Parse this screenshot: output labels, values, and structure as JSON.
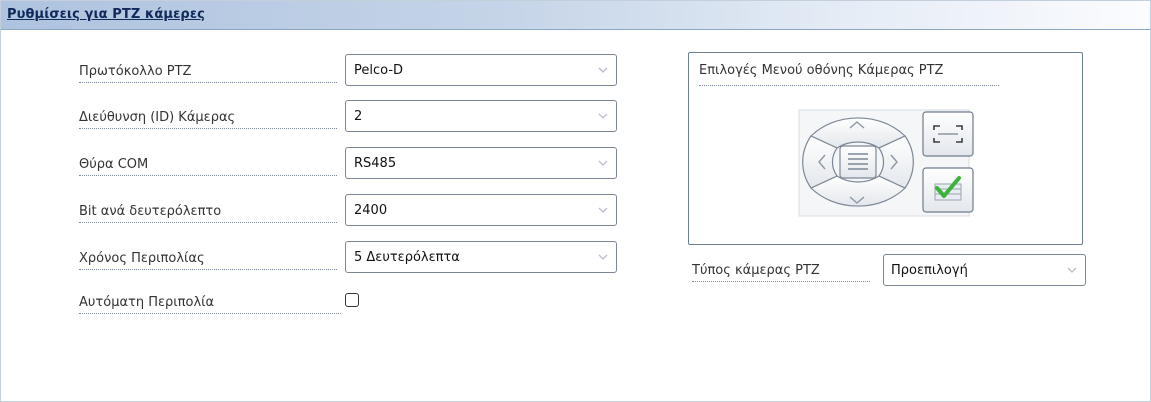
{
  "panel": {
    "title": "Ρυθμίσεις για PTZ κάμερες"
  },
  "settings": {
    "protocol_label": "Πρωτόκολλο PTZ",
    "protocol_value": "Pelco-D",
    "camera_id_label": "Διεύθυνση (ID) Κάμερας",
    "camera_id_value": "2",
    "com_port_label": "Θύρα COM",
    "com_port_value": "RS485",
    "baud_label": "Bit ανά δευτερόλεπτο",
    "baud_value": "2400",
    "patrol_time_label": "Χρόνος Περιπολίας",
    "patrol_time_value": "5 Δευτερόλεπτα",
    "auto_patrol_label": "Αυτόματη Περιπολία",
    "auto_patrol_checked": false
  },
  "osd_menu": {
    "title": "Επιλογές Μενού οθόνης Κάμερας PTZ",
    "icons": [
      "chevron-up-icon",
      "chevron-left-icon",
      "menu-icon",
      "chevron-right-icon",
      "chevron-down-icon",
      "fullscreen-icon",
      "checkmark-icon"
    ]
  },
  "ptz_type": {
    "label": "Τύπος κάμερας PTZ",
    "value": "Προεπιλογή"
  },
  "colors": {
    "header_start": "#aec3df",
    "header_text": "#10285a",
    "control_border": "#7d8694",
    "checkmark": "#3cb43c"
  }
}
